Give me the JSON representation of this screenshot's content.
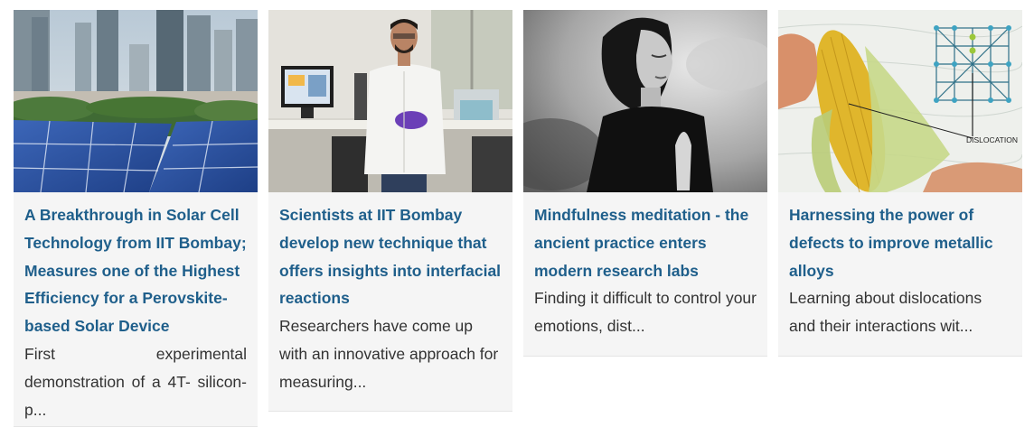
{
  "cards": [
    {
      "title": "A Breakthrough in Solar Cell Technology from IIT Bombay; Measures one of the Highest Efficiency for a Perovskite-based Solar Device",
      "excerpt": "First experimental demonstration of a 4T- silicon-p..."
    },
    {
      "title": "Scientists at IIT Bombay develop new technique that offers insights into interfacial reactions",
      "excerpt": "Researchers have come up with an innovative approach for measuring..."
    },
    {
      "title": "Mindfulness meditation - the ancient practice enters modern research labs",
      "excerpt": "Finding it difficult to control your emotions, dist..."
    },
    {
      "title": "Harnessing the power of defects to improve metallic alloys",
      "excerpt": "Learning about dislocations and their interactions wit...",
      "image_label": "DISLOCATION"
    }
  ]
}
